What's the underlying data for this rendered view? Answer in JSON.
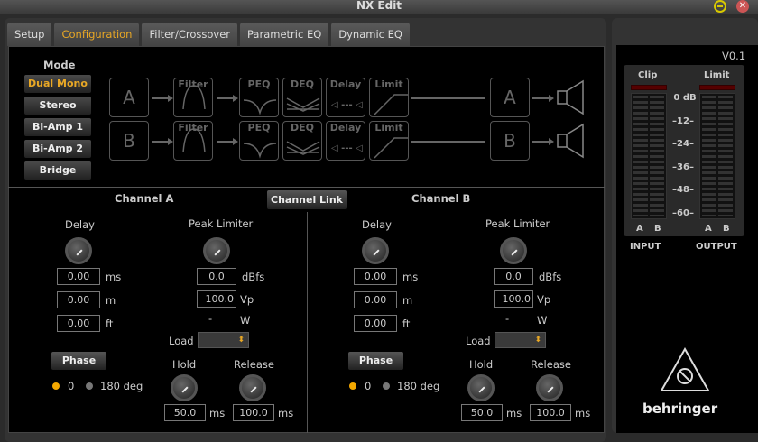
{
  "window": {
    "title": "NX Edit"
  },
  "tabs": [
    "Setup",
    "Configuration",
    "Filter/Crossover",
    "Parametric EQ",
    "Dynamic EQ"
  ],
  "active_tab": "Configuration",
  "mode": {
    "label": "Mode",
    "options": [
      "Dual Mono",
      "Stereo",
      "Bi-Amp 1",
      "Bi-Amp 2",
      "Bridge"
    ],
    "selected": "Dual Mono"
  },
  "diagram": {
    "inputs": [
      "A",
      "B"
    ],
    "blocks": [
      "Filter",
      "PEQ",
      "DEQ",
      "Delay",
      "Limit"
    ],
    "outputs": [
      "A",
      "B"
    ]
  },
  "channel_link": "Channel Link",
  "channels": [
    {
      "title": "Channel A",
      "delay_label": "Delay",
      "delay_ms": "0.00",
      "delay_m": "0.00",
      "delay_ft": "0.00",
      "u_ms": "ms",
      "u_m": "m",
      "u_ft": "ft",
      "peak_label": "Peak Limiter",
      "peak_dbfs": "0.0",
      "u_dbfs": "dBfs",
      "peak_vp": "100.0",
      "u_vp": "Vp",
      "watts": "-",
      "u_w": "W",
      "load_label": "Load",
      "phase": "Phase",
      "phase_0": "0",
      "phase_180": "180 deg",
      "hold_label": "Hold",
      "hold": "50.0",
      "release_label": "Release",
      "release": "100.0",
      "u_hold": "ms",
      "u_rel": "ms"
    },
    {
      "title": "Channel B",
      "delay_label": "Delay",
      "delay_ms": "0.00",
      "delay_m": "0.00",
      "delay_ft": "0.00",
      "u_ms": "ms",
      "u_m": "m",
      "u_ft": "ft",
      "peak_label": "Peak Limiter",
      "peak_dbfs": "0.0",
      "u_dbfs": "dBfs",
      "peak_vp": "100.0",
      "u_vp": "Vp",
      "watts": "-",
      "u_w": "W",
      "load_label": "Load",
      "phase": "Phase",
      "phase_0": "0",
      "phase_180": "180 deg",
      "hold_label": "Hold",
      "hold": "50.0",
      "release_label": "Release",
      "release": "100.0",
      "u_hold": "ms",
      "u_rel": "ms"
    }
  ],
  "meters": {
    "version": "V0.1",
    "clip": "Clip",
    "limit": "Limit",
    "scale": [
      "0 dB",
      "12",
      "24",
      "36",
      "48",
      "60"
    ],
    "ch": [
      "A",
      "B"
    ],
    "input": "INPUT",
    "output": "OUTPUT"
  },
  "brand": "behringer",
  "colors": {
    "accent": "#e9a825"
  }
}
